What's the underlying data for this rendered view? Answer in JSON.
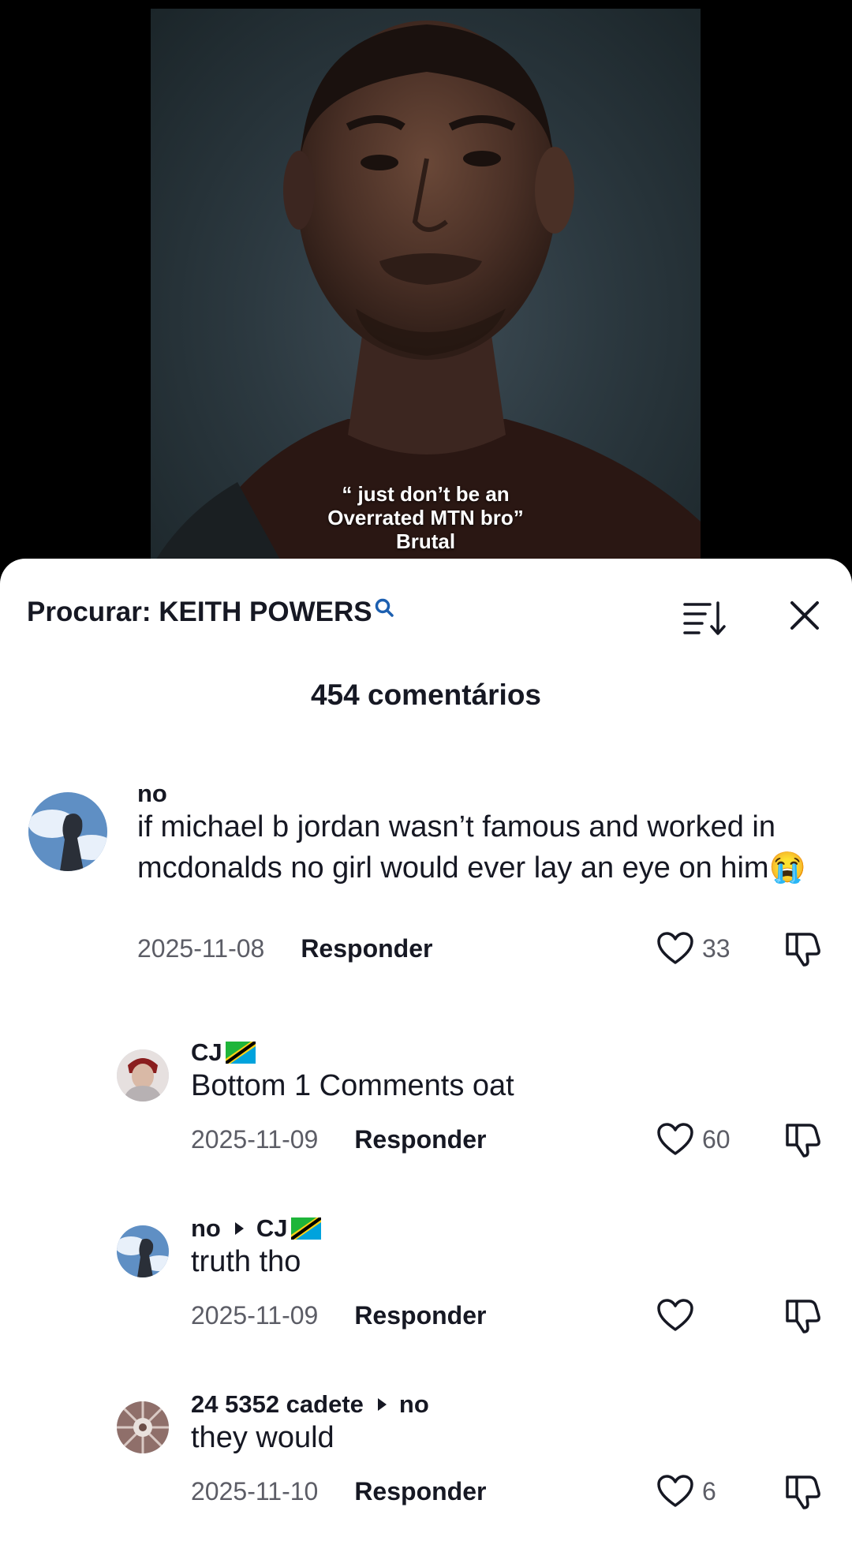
{
  "video": {
    "caption_lines": [
      "“ just don’t be an",
      "Overrated MTN bro”",
      "Brutal"
    ]
  },
  "sheet": {
    "search_label": "Procurar: KEITH POWERS",
    "count_label": "454 comentários"
  },
  "comments": [
    {
      "user": "no",
      "text": "if michael b jordan wasn’t famous and worked in mcdonalds no girl would ever lay an eye on him😭",
      "date": "2025-11-08",
      "reply_label": "Responder",
      "likes": "33"
    },
    {
      "user": "CJ",
      "user_flag": "Tanzania",
      "text": "Bottom 1 Comments oat",
      "date": "2025-11-09",
      "reply_label": "Responder",
      "likes": "60"
    },
    {
      "user": "no",
      "reply_to": "CJ",
      "reply_to_flag": "Tanzania",
      "text": "truth tho",
      "date": "2025-11-09",
      "reply_label": "Responder",
      "likes": ""
    },
    {
      "user": "24 5352 cadete",
      "reply_to": "no",
      "text": "they would",
      "date": "2025-11-10",
      "reply_label": "Responder",
      "likes": "6"
    }
  ],
  "colors": {
    "accent_link": "#1c5fb0",
    "text_primary": "#161823",
    "text_secondary": "#5c5d66"
  }
}
